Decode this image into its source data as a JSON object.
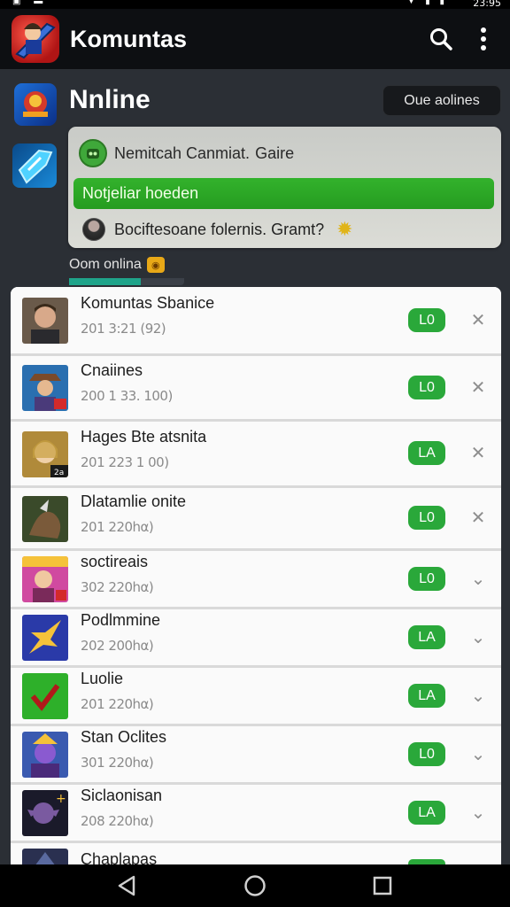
{
  "app": {
    "title": "Komuntas"
  },
  "section": {
    "title": "Nnline",
    "online_button": "Oue aolines"
  },
  "notification": {
    "line1_prefix": "Nemitcah Canmiat.",
    "line1_suffix": "Gaire",
    "green_banner": "Notjeliar hoeden",
    "line3": "Bociftesoane folernis. Gramt?"
  },
  "online_count": {
    "label": "Oom onlina",
    "badge": "◉"
  },
  "online_progress": 0.62,
  "list": [
    {
      "name": "Komuntas Sbanice",
      "meta": "201 3:21 (92)",
      "pill": "L0",
      "thumb": "portrait-man"
    },
    {
      "name": "Cnaiines",
      "meta": "200 1 33. 100)",
      "pill": "L0",
      "thumb": "cowboy-hero"
    },
    {
      "name": "Hages Bte atsnita",
      "meta": "201 223 1 00)",
      "pill": "LA",
      "thumb": "elf-warrior"
    },
    {
      "name": "Dlatamlie onite",
      "meta": "201 220hα)",
      "pill": "L0",
      "thumb": "dark-beast"
    },
    {
      "name": "soctireais",
      "meta": "302 220hα)",
      "pill": "L0",
      "thumb": "pink-fighter"
    },
    {
      "name": "Podlmmine",
      "meta": "202 200hα)",
      "pill": "LA",
      "thumb": "blue-star"
    },
    {
      "name": "Luolie",
      "meta": "201 220hα)",
      "pill": "LA",
      "thumb": "green-check"
    },
    {
      "name": "Stan Oclites",
      "meta": "301 220hα)",
      "pill": "L0",
      "thumb": "purple-mage"
    },
    {
      "name": "Siclaonisan",
      "meta": "208 220hα)",
      "pill": "LA",
      "thumb": "shadow-elf"
    },
    {
      "name": "Chaplapas",
      "meta": "",
      "pill": "",
      "thumb": "dark-knight"
    }
  ],
  "colors": {
    "accent_green": "#2aa83a",
    "app_bar": "#0d0f12",
    "background": "#2b2f35"
  }
}
